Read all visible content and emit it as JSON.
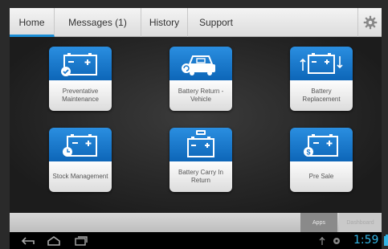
{
  "tabs": [
    {
      "label": "Home",
      "active": true
    },
    {
      "label": "Messages (1)",
      "active": false
    },
    {
      "label": "History",
      "active": false
    },
    {
      "label": "Support",
      "active": false
    }
  ],
  "settings_icon": "gear-icon",
  "tiles": [
    {
      "label": "Preventative Maintenance",
      "icon": "battery-check-icon"
    },
    {
      "label": "Battery Return - Vehicle",
      "icon": "car-return-icon"
    },
    {
      "label": "Battery Replacement",
      "icon": "battery-replace-icon"
    },
    {
      "label": "Stock Management",
      "icon": "battery-clock-icon"
    },
    {
      "label": "Battery Carry In Return",
      "icon": "battery-carry-icon"
    },
    {
      "label": "Pre Sale",
      "icon": "battery-dollar-icon"
    }
  ],
  "bottom_tabs": {
    "apps": "Apps",
    "second": "Dashboard"
  },
  "status": {
    "time": "1:59"
  },
  "colors": {
    "accent": "#1b8ed6",
    "tile_blue": "#1a7ad0",
    "clock": "#33b5e5"
  }
}
